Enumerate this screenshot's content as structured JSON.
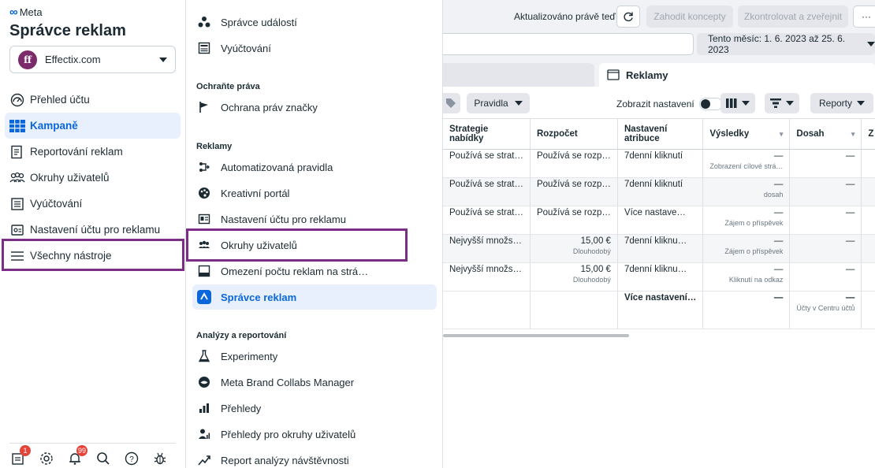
{
  "sidebar": {
    "brand": "Meta",
    "title": "Správce reklam",
    "account": {
      "initials": "ff",
      "name": "Effectix.com"
    },
    "items": [
      {
        "label": "Přehled účtu",
        "icon": "gauge-icon"
      },
      {
        "label": "Kampaně",
        "icon": "table-grid-icon",
        "active": true
      },
      {
        "label": "Reportování reklam",
        "icon": "report-icon"
      },
      {
        "label": "Okruhy uživatelů",
        "icon": "audience-icon"
      },
      {
        "label": "Vyúčtování",
        "icon": "billing-icon"
      },
      {
        "label": "Nastavení účtu pro reklamu",
        "icon": "account-settings-icon"
      },
      {
        "label": "Všechny nástroje",
        "icon": "hamburger-icon"
      }
    ],
    "bottom": {
      "notifications_badge": "1",
      "alerts_badge": "99"
    }
  },
  "tools": {
    "top_items": [
      "Správce událostí",
      "Vyúčtování"
    ],
    "sections": [
      {
        "title": "Ochraňte práva",
        "items": [
          "Ochrana práv značky"
        ]
      },
      {
        "title": "Reklamy",
        "items": [
          "Automatizovaná pravidla",
          "Kreativní portál",
          "Nastavení účtu pro reklamu",
          "Okruhy uživatelů",
          "Omezení počtu reklam na strá…",
          "Správce reklam"
        ]
      },
      {
        "title": "Analýzy a reportování",
        "items": [
          "Experimenty",
          "Meta Brand Collabs Manager",
          "Přehledy",
          "Přehledy pro okruhy uživatelů",
          "Report analýzy návštěvnosti"
        ]
      }
    ]
  },
  "main": {
    "updated": "Aktualizováno právě teď",
    "discard": "Zahodit koncepty",
    "review": "Zkontrolovat a zveřejnit",
    "more": "···",
    "date_range": "Tento měsíc: 1. 6. 2023 až 25. 6. 2023",
    "tab_ads": "Reklamy",
    "rules": "Pravidla",
    "show_settings": "Zobrazit nastavení",
    "reports": "Reporty",
    "columns": [
      "Strategie nabídky",
      "Rozpočet",
      "Nastavení atribuce",
      "Výsledky",
      "Dosah",
      "Z"
    ],
    "rows": [
      {
        "strategy": "Používá se strat…",
        "budget": "Používá se rozp…",
        "budget_sub": "",
        "attr": "7denní kliknutí",
        "results": "—",
        "results_sub": "Zobrazení cílové strá…",
        "reach": "—"
      },
      {
        "strategy": "Používá se strat…",
        "budget": "Používá se rozp…",
        "budget_sub": "",
        "attr": "7denní kliknutí",
        "results": "—",
        "results_sub": "dosah",
        "reach": "—"
      },
      {
        "strategy": "Používá se strat…",
        "budget": "Používá se rozp…",
        "budget_sub": "",
        "attr": "Více nastave…",
        "results": "—",
        "results_sub": "Zájem o příspěvek",
        "reach": "—"
      },
      {
        "strategy": "Nejvyšší množs…",
        "budget": "15,00 €",
        "budget_sub": "Dlouhodobý",
        "attr": "7denní kliknu…",
        "results": "—",
        "results_sub": "Zájem o příspěvek",
        "reach": "—"
      },
      {
        "strategy": "Nejvyšší množs…",
        "budget": "15,00 €",
        "budget_sub": "Dlouhodobý",
        "attr": "7denní kliknu…",
        "results": "—",
        "results_sub": "Kliknutí na odkaz",
        "reach": "—"
      }
    ],
    "total": {
      "attr": "Více nastavení…",
      "results": "—",
      "reach": "—",
      "reach_sub": "Účty v Centru účtů"
    }
  }
}
